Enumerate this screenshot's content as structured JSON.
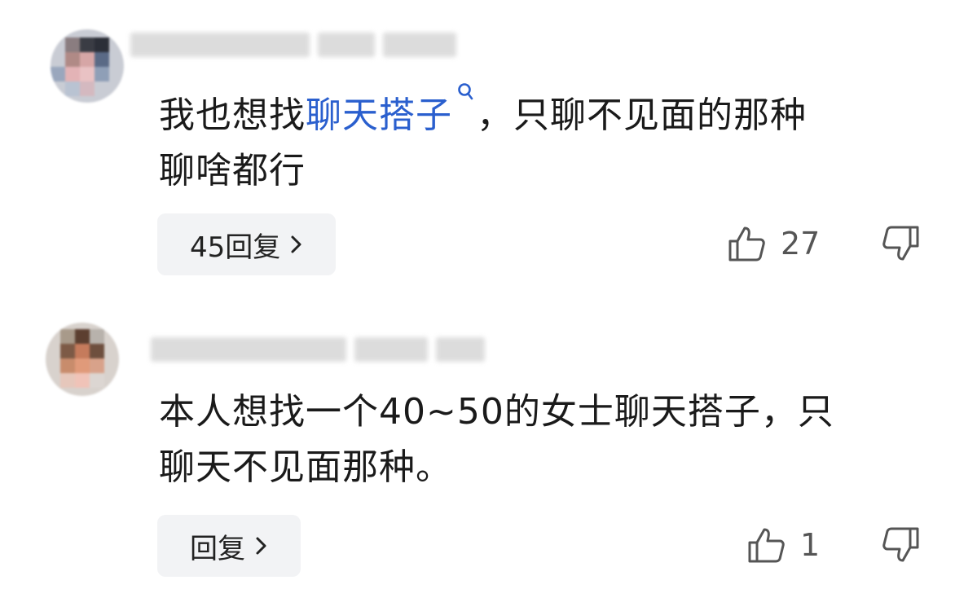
{
  "comments": [
    {
      "text_before_link": "我也想找",
      "link_text": "聊天搭子",
      "text_after_link": "，只聊不见面的那种",
      "text_line2": "聊啥都行",
      "reply_label": "45回复",
      "like_count": "27"
    },
    {
      "text_line1": "本人想找一个40~50的女士聊天搭子，只",
      "text_line2": "聊天不见面那种。",
      "reply_label": "回复",
      "like_count": "1"
    }
  ],
  "icons": {
    "like": "thumbs-up-icon",
    "dislike": "thumbs-down-icon",
    "search": "search-icon",
    "chevron": "chevron-right-icon"
  },
  "colors": {
    "link": "#2a5fce",
    "reply_bg": "#f2f3f5",
    "icon": "#555555"
  }
}
